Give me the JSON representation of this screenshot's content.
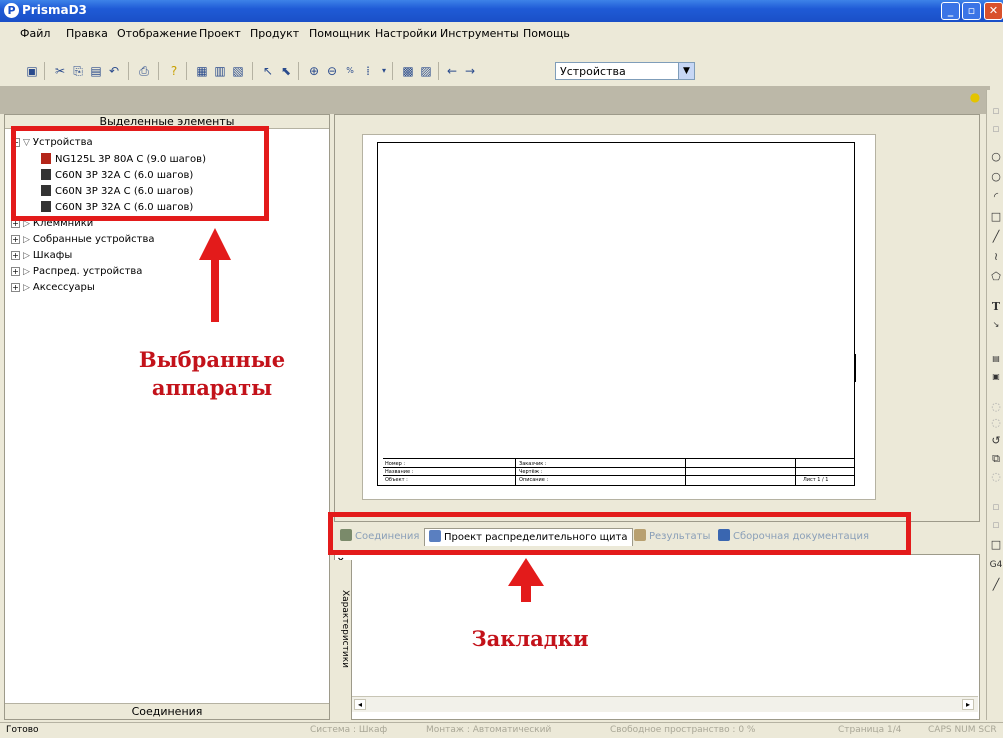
{
  "window": {
    "title": "PrismaD3",
    "app_icon": "P"
  },
  "menu": [
    "Файл",
    "Правка",
    "Отображение",
    "Проект",
    "Продукт",
    "Помощник",
    "Настройки",
    "Инструменты",
    "Помощь"
  ],
  "toolbar": {
    "combo_value": "Устройства"
  },
  "left_panel": {
    "header": "Выделенные элементы",
    "footer": "Соединения",
    "tree": {
      "root": "Устройства",
      "devices": [
        "NG125L 3P 80A  C (9.0 шагов)",
        "C60N 3P 32A  C (6.0 шагов)",
        "C60N 3P 32A  C (6.0 шагов)",
        "C60N 3P 32A  C (6.0 шагов)"
      ],
      "partial_node": "Клеммники",
      "other_nodes": [
        "Собранные устройства",
        "Шкафы",
        "Распред. устройства",
        "Аксессуары"
      ]
    }
  },
  "title_block": {
    "c1": [
      "Номер :",
      "Название :",
      "Объект :"
    ],
    "c2": [
      "Заказчик :",
      "Чертёж :",
      "Описание :"
    ],
    "sheet": "Лист 1 / 1"
  },
  "tabs": [
    "Соединения",
    "Проект распределительного щита",
    "Результаты",
    "Сборочная документация"
  ],
  "bottom_panel": {
    "side_label": "Характеристики"
  },
  "status_bar": [
    "Готово",
    "Система : Шкаф",
    "Монтаж : Автоматический",
    "Свободное пространство : 0 %",
    "Страница 1/4",
    "CAPS  NUM  SCR"
  ],
  "annotations": {
    "selected_label_line1": "Выбранные",
    "selected_label_line2": "аппараты",
    "tabs_label": "Закладки",
    "color": "#e31b1b"
  }
}
